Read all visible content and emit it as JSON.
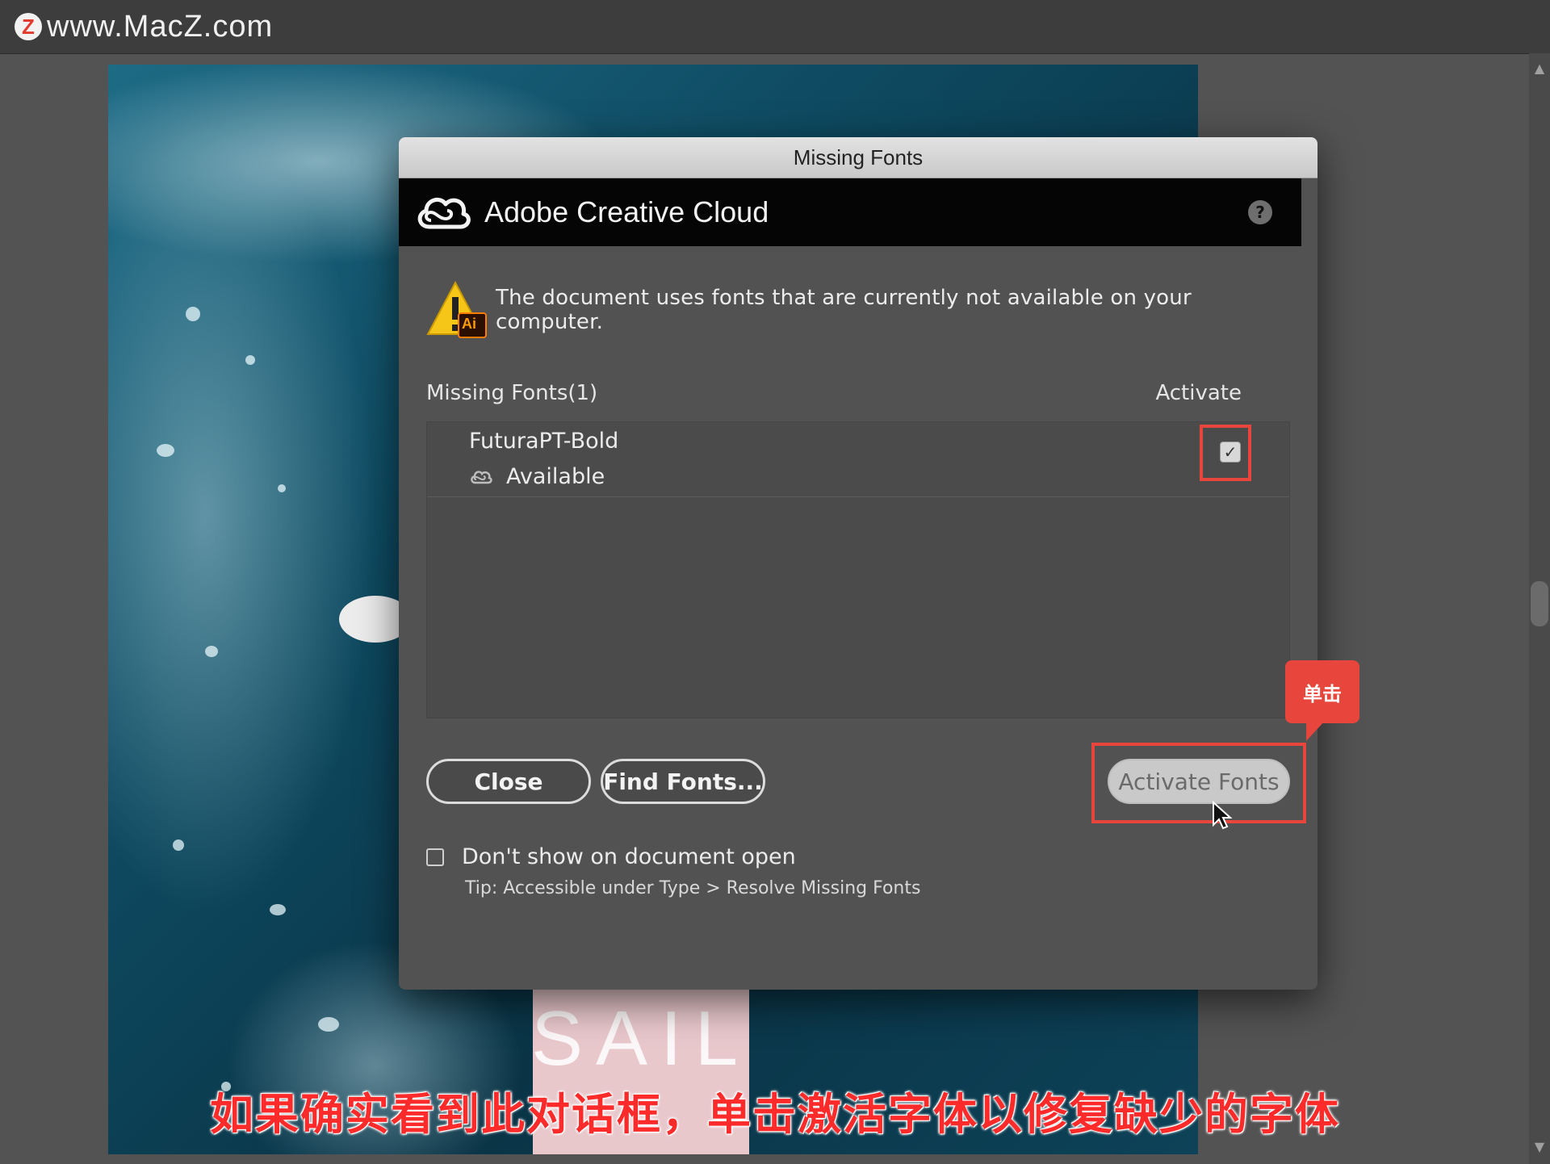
{
  "watermark": {
    "logo_glyph": "Z",
    "text": "www.MacZ.com"
  },
  "artboard": {
    "sail_text": "SAIL"
  },
  "dialog": {
    "window_title": "Missing Fonts",
    "brand_title": "Adobe Creative Cloud",
    "help_glyph": "?",
    "warning_badge": "Ai",
    "warning_message": "The document uses fonts that are currently not available on your computer.",
    "list_header_left": "Missing Fonts(1)",
    "list_header_right": "Activate",
    "fonts": [
      {
        "name": "FuturaPT-Bold",
        "status": "Available",
        "activate_checked": true
      }
    ],
    "buttons": {
      "close": "Close",
      "find_fonts": "Find Fonts...",
      "activate_fonts": "Activate Fonts"
    },
    "dont_show_label": "Don't show on document open",
    "dont_show_checked": false,
    "tip": "Tip: Accessible under Type > Resolve Missing Fonts"
  },
  "annotations": {
    "callout": "单击",
    "subtitle": "如果确实看到此对话框，单击激活字体以修复缺少的字体"
  },
  "colors": {
    "highlight": "#e8453c",
    "subtitle": "#ff2a2a",
    "dialog_bg": "#525252",
    "header_bg": "#050505"
  }
}
